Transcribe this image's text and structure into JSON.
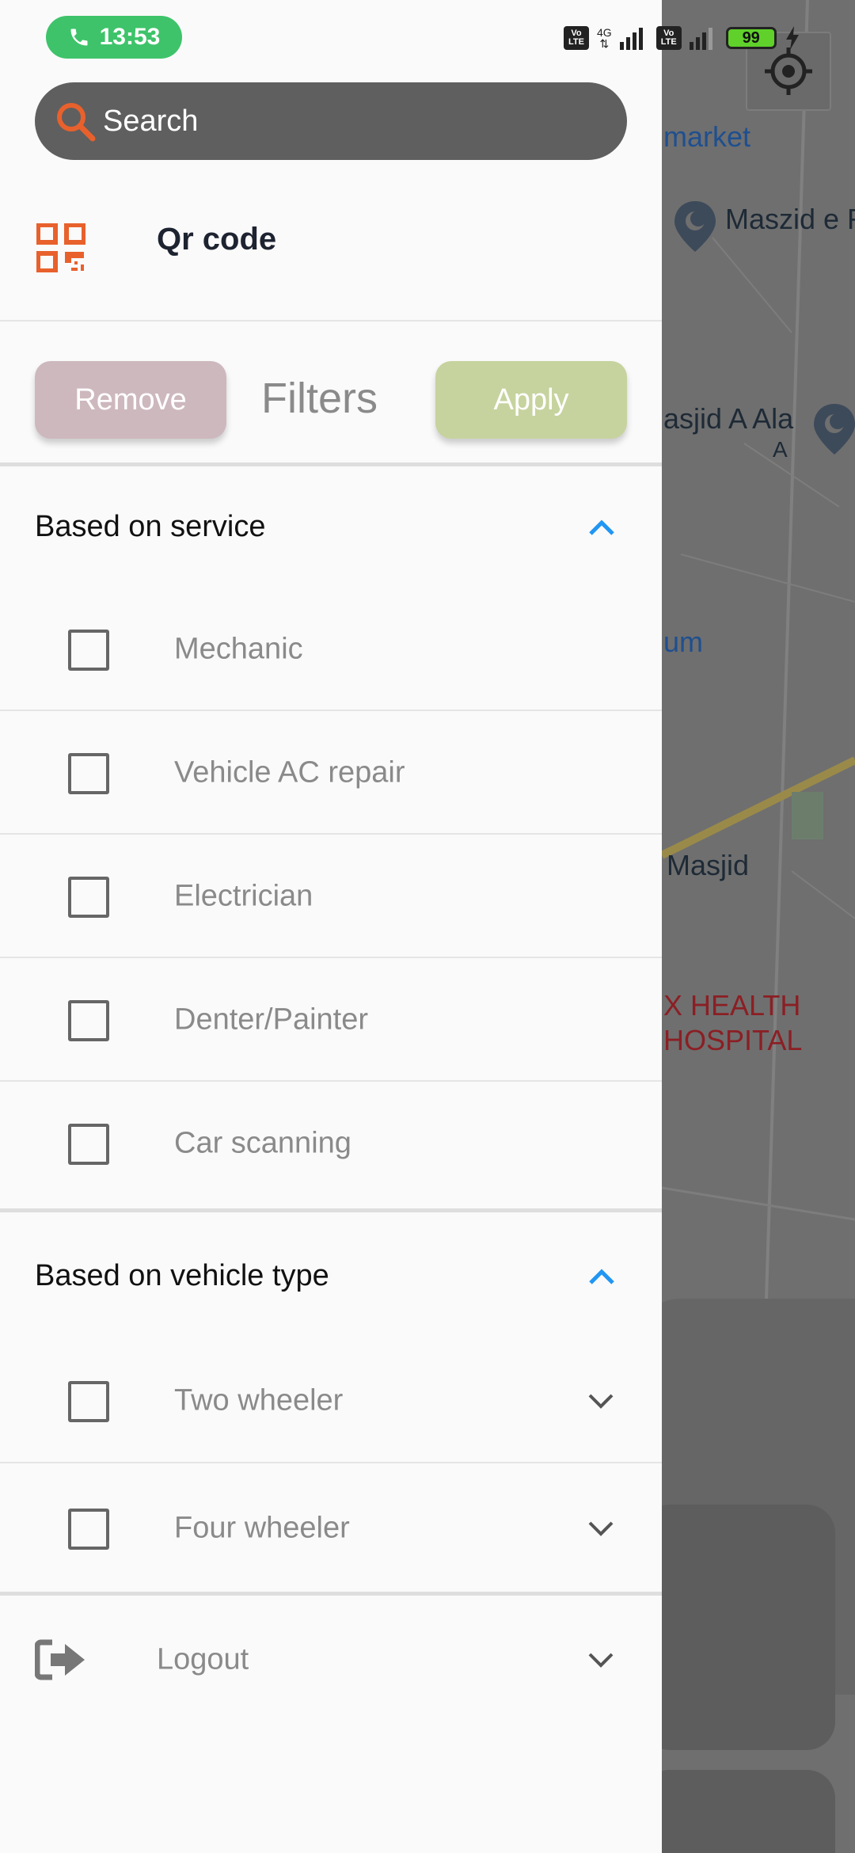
{
  "status_bar": {
    "time": "13:53",
    "network": "4G",
    "battery": "99"
  },
  "search": {
    "placeholder": "Search"
  },
  "qr": {
    "label": "Qr code"
  },
  "filters": {
    "title": "Filters",
    "remove_label": "Remove",
    "apply_label": "Apply"
  },
  "service_section": {
    "title": "Based on service",
    "items": [
      "Mechanic",
      "Vehicle AC repair",
      "Electrician",
      "Denter/Painter",
      "Car scanning"
    ]
  },
  "vehicle_section": {
    "title": "Based on vehicle type",
    "items": [
      "Two wheeler",
      "Four wheeler"
    ]
  },
  "logout": {
    "label": "Logout"
  },
  "map": {
    "labels": [
      "market",
      "Maszid e F",
      "asjid A Ala",
      "A",
      "um",
      "Masjid",
      "X HEALTH",
      "HOSPITAL"
    ]
  },
  "colors": {
    "accent_orange": "#e8612c",
    "remove_button": "#cdb8be",
    "apply_button": "#c6d39e",
    "chevron_blue": "#2196f3",
    "status_green": "#3ec36a"
  }
}
